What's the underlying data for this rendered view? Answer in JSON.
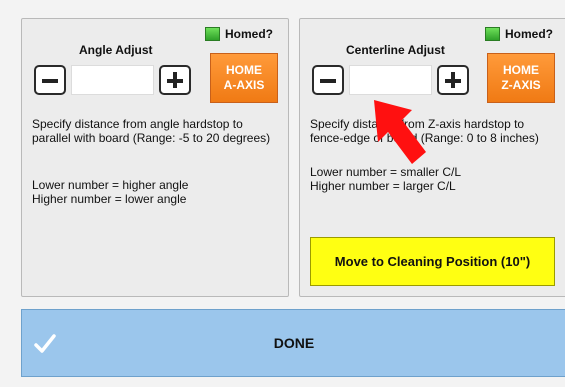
{
  "left_panel": {
    "homed_label": "Homed?",
    "title": "Angle Adjust",
    "value": "",
    "home_button_line1": "HOME",
    "home_button_line2": "A-AXIS",
    "desc1": "Specify distance from angle hardstop to parallel with board (Range: -5 to 20 degrees)",
    "desc2_line1": "Lower number = higher angle",
    "desc2_line2": "Higher number = lower angle"
  },
  "right_panel": {
    "homed_label": "Homed?",
    "title": "Centerline Adjust",
    "value": "",
    "home_button_line1": "HOME",
    "home_button_line2": "Z-AXIS",
    "desc1": "Specify distance from Z-axis hardstop to fence-edge of board (Range: 0 to 8 inches)",
    "desc2_line1": "Lower number = smaller C/L",
    "desc2_line2": "Higher number = larger C/L",
    "clean_button": "Move to Cleaning Position (10\")"
  },
  "done_button": {
    "label": "DONE"
  },
  "colors": {
    "homed_led": "#3fbf34",
    "home_button": "#f5821f",
    "clean_button": "#ffff12",
    "done_button": "#9bc6ec",
    "arrow": "#ff1010"
  }
}
